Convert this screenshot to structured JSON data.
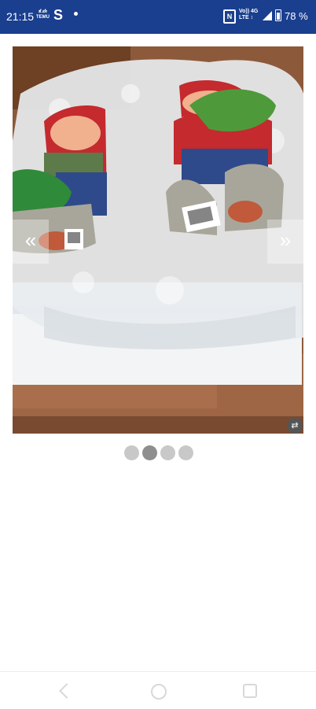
{
  "status_bar": {
    "time": "21:15",
    "app_badge_line1": "ತೆ.ಪೇ",
    "app_badge_line2": "TEMU",
    "app_letter": "S",
    "network_line1": "Vo)) 4G",
    "network_line2": "LTE ↕",
    "battery_percent": "78 %"
  },
  "gallery": {
    "prev_glyph": "«",
    "next_glyph": "»",
    "swap_glyph": "⇄",
    "page_count": 4,
    "active_index": 1
  },
  "colors": {
    "status_bar_bg": "#1a3f8f",
    "dot_active": "#8e8e8e",
    "dot_inactive": "#c8c8c8"
  }
}
